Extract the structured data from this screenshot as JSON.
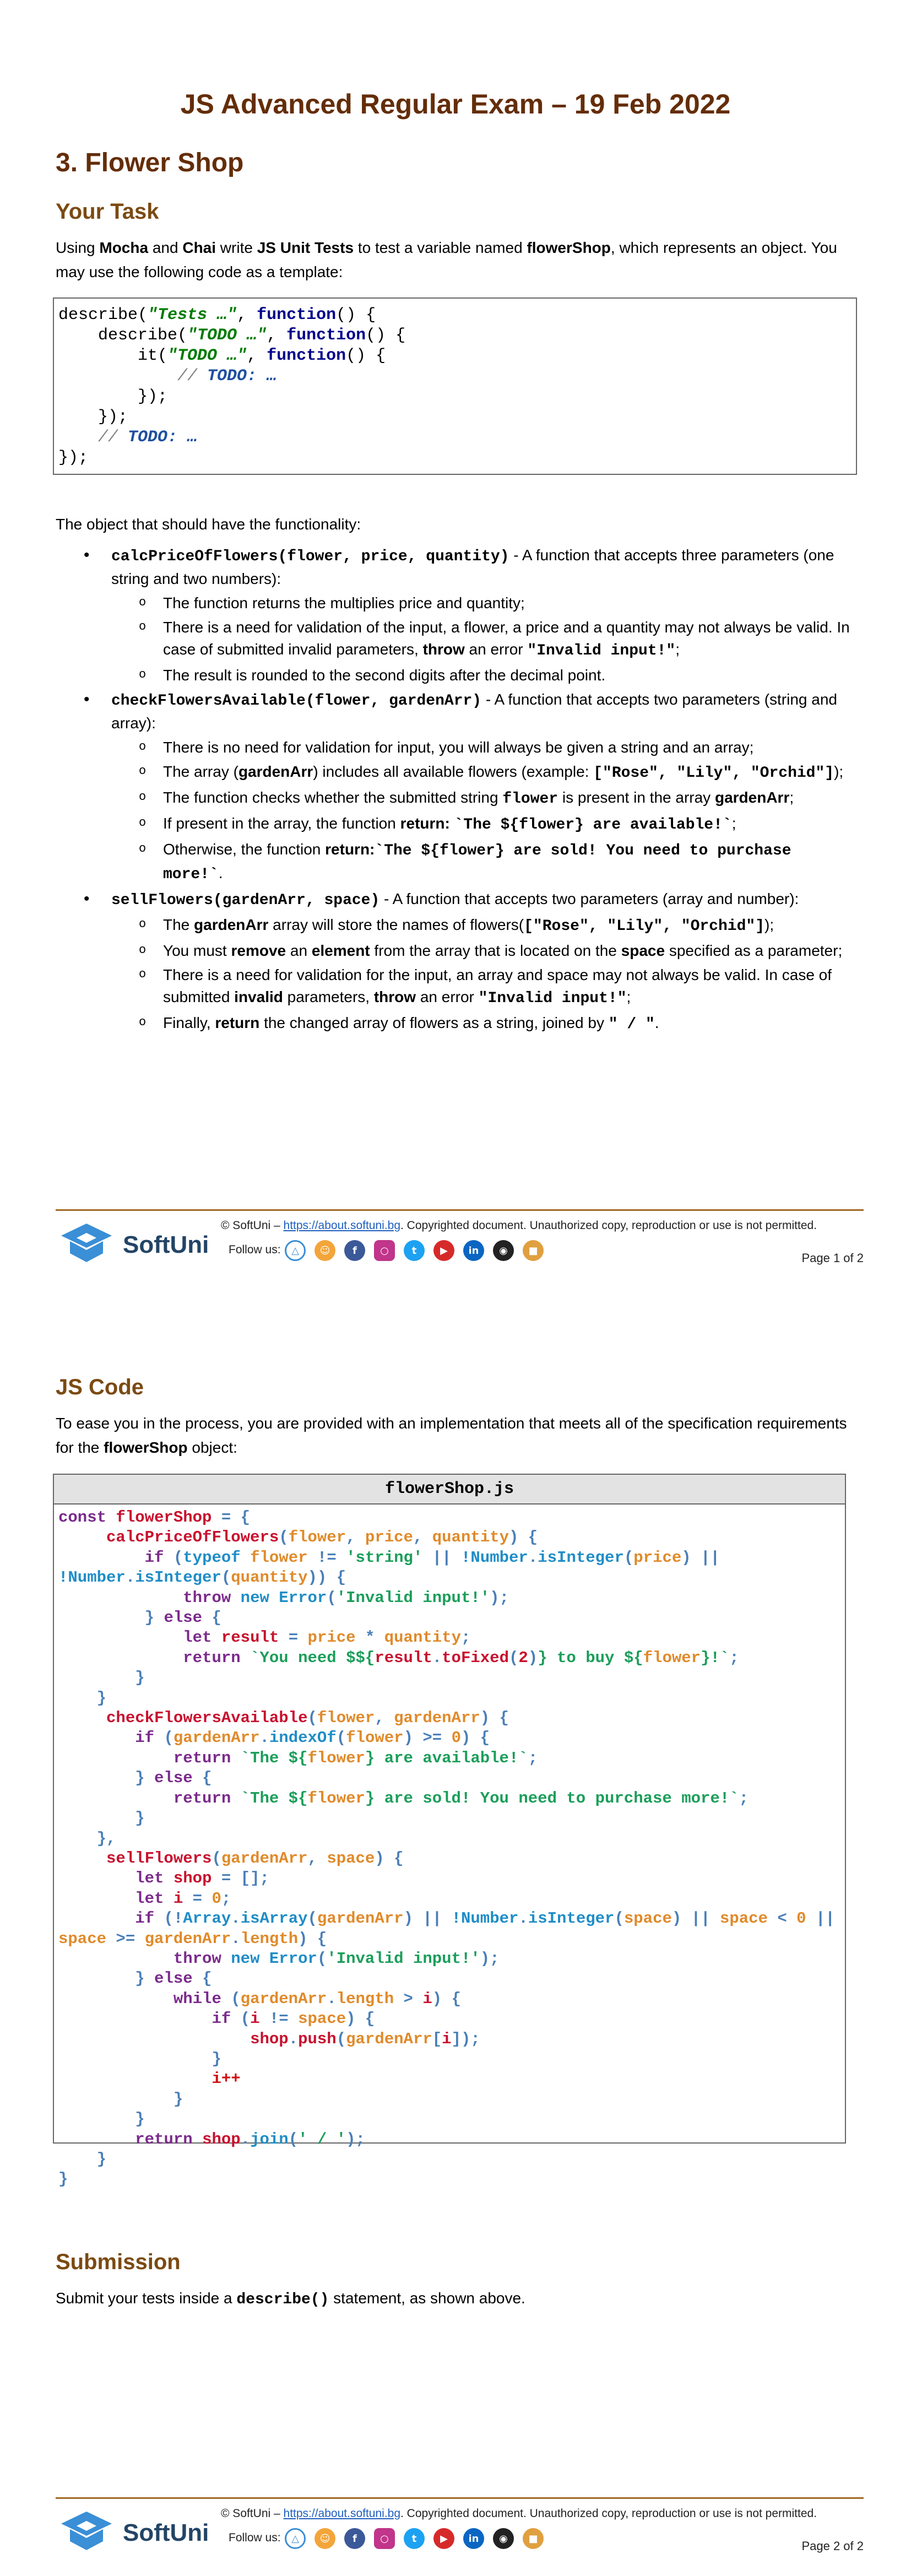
{
  "page1": {
    "main_title": "JS Advanced Regular Exam – 19 Feb 2022",
    "section_title": "3. Flower Shop",
    "your_task_heading": "Your Task",
    "intro": {
      "p1": "Using ",
      "mocha": "Mocha",
      "p2": " and ",
      "chai": "Chai",
      "p3": " write ",
      "jsunit": "JS Unit Tests",
      "p4": " to test a variable named ",
      "flowershop": "flowerShop",
      "p5": ", which represents an object. You may use the following code as a template:"
    },
    "template_code": {
      "l1a": "describe(",
      "l1b": "\"Tests …\"",
      "l1c": ", ",
      "l1d": "function",
      "l1e": "() {",
      "l2a": "    describe(",
      "l2b": "\"TODO …\"",
      "l2c": ", ",
      "l2d": "function",
      "l2e": "() {",
      "l3a": "        it(",
      "l3b": "\"TODO …\"",
      "l3c": ", ",
      "l3d": "function",
      "l3e": "() {",
      "l4a": "            // ",
      "l4b": "TODO: …",
      "l5": "        });",
      "l6": "    });",
      "l7a": "    // ",
      "l7b": "TODO: …",
      "l8": "});"
    },
    "functionality_intro": "The object that should have the functionality:",
    "items": [
      {
        "sig": "calcPriceOfFlowers(flower, price, quantity)",
        "desc": " - A function that accepts three parameters (one string and two numbers):",
        "subs": [
          {
            "t": "The function returns the multiplies price and quantity;"
          },
          {
            "t1": "There is a need for validation of the input, a flower, a price and a quantity may not always be valid. In case of submitted invalid parameters, ",
            "b1": "throw",
            "t2": " an error ",
            "c1": "\"Invalid input!\"",
            "t3": ";"
          },
          {
            "t": "The result is rounded to the second digits after the decimal point."
          }
        ]
      },
      {
        "sig": "checkFlowersAvailable(flower, gardenArr)",
        "desc": " - A function that accepts two parameters (string and array):",
        "subs": [
          {
            "t": "There is no need for validation for input, you will always be given a string and an array;"
          },
          {
            "t1": "The array (",
            "b1": "gardenArr",
            "t2": ") includes all available flowers (example: ",
            "c1": "[\"Rose\", \"Lily\", \"Orchid\"]",
            "t3": ");"
          },
          {
            "t1": "The function checks whether the submitted string ",
            "c1": "flower",
            "t2": " is present in the array ",
            "b1": "gardenArr",
            "t3": ";"
          },
          {
            "t1": "If present in the array, the function ",
            "b1": "return:",
            "t2": " ",
            "c1": "`The ${flower} are available!`",
            "t3": ";"
          },
          {
            "t1": "Otherwise, the function ",
            "b1": "return:",
            "t2": "",
            "c1": "`The ${flower} are sold! You need to purchase more!`",
            "t3": "."
          }
        ]
      },
      {
        "sig": "sellFlowers(gardenArr, space)",
        "desc": " - A function that accepts two parameters (array and number):",
        "subs": [
          {
            "t1": "The ",
            "b1": "gardenArr",
            "t2": "  array will store the names of flowers(",
            "c1": "[\"Rose\", \"Lily\", \"Orchid\"]",
            "t3": ");"
          },
          {
            "t1": "You must ",
            "b1": "remove",
            "t2": " an ",
            "b2": "element",
            "t3": " from the array that is located on the ",
            "b3": "space",
            "t4": " specified as a parameter;"
          },
          {
            "t1": "There is a need for validation for the input, an array and space may not always be valid. In case of submitted ",
            "b1": "invalid",
            "t2": " parameters, ",
            "b2": "throw",
            "t3": " an error ",
            "c1": "\"Invalid input!\"",
            "t4": ";"
          },
          {
            "t1": "Finally, ",
            "b1": "return",
            "t2": " the changed array of flowers as a string, joined by ",
            "c1": "\" / \"",
            "t3": "."
          }
        ]
      }
    ],
    "page_number": "Page 1 of 2"
  },
  "footer": {
    "logo_text": "SoftUni",
    "copyright_pre": "© SoftUni – ",
    "copyright_link": "https://about.softuni.bg",
    "copyright_post": ". Copyrighted document. Unauthorized copy, reproduction or use is not permitted.",
    "follow_us": "Follow us:",
    "social_icons": [
      "softuni-hat-icon",
      "softuni-smile-icon",
      "facebook-icon",
      "instagram-icon",
      "twitter-icon",
      "youtube-icon",
      "linkedin-icon",
      "github-icon",
      "softuni-box-icon"
    ]
  },
  "page2": {
    "js_code_heading": "JS Code",
    "intro_text": "To ease you in the process, you are provided with an implementation that meets all of the specification requirements for the ",
    "intro_bold": "flowerShop",
    "intro_end": " object:",
    "code_file_name": "flowerShop.js",
    "submission_heading": "Submission",
    "submission_pre": "Submit your tests inside a ",
    "submission_code": "describe()",
    "submission_post": " statement, as shown above.",
    "page_number": "Page 2 of 2"
  },
  "colors": {
    "heading_brown": "#642d08",
    "footer_line": "#a06a23",
    "softuni_blue": "#234465"
  }
}
